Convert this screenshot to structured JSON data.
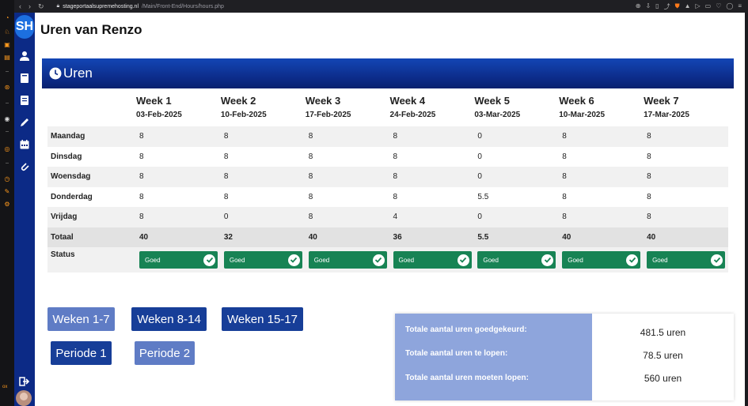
{
  "browser": {
    "host": "stageportaalsupremehosting.nl",
    "path": "/Main/Front-End/Hours/hours.php"
  },
  "os_bar": {
    "label": "ox"
  },
  "sidebar": {
    "logo_text": "SH",
    "items": [
      {
        "icon": "user-icon"
      },
      {
        "icon": "book-icon"
      },
      {
        "icon": "notebook-icon"
      },
      {
        "icon": "pencil-icon"
      },
      {
        "icon": "calendar-icon"
      },
      {
        "icon": "paperclip-icon"
      }
    ],
    "logout_icon": "logout-icon"
  },
  "page": {
    "title": "Uren van Renzo",
    "card_title": "Uren"
  },
  "hours_table": {
    "weeks": [
      {
        "label": "Week 1",
        "date": "03-Feb-2025"
      },
      {
        "label": "Week 2",
        "date": "10-Feb-2025"
      },
      {
        "label": "Week 3",
        "date": "17-Feb-2025"
      },
      {
        "label": "Week 4",
        "date": "24-Feb-2025"
      },
      {
        "label": "Week 5",
        "date": "03-Mar-2025"
      },
      {
        "label": "Week 6",
        "date": "10-Mar-2025"
      },
      {
        "label": "Week 7",
        "date": "17-Mar-2025"
      }
    ],
    "rows": [
      {
        "day": "Maandag",
        "values": [
          "8",
          "8",
          "8",
          "8",
          "0",
          "8",
          "8"
        ]
      },
      {
        "day": "Dinsdag",
        "values": [
          "8",
          "8",
          "8",
          "8",
          "0",
          "8",
          "8"
        ]
      },
      {
        "day": "Woensdag",
        "values": [
          "8",
          "8",
          "8",
          "8",
          "0",
          "8",
          "8"
        ]
      },
      {
        "day": "Donderdag",
        "values": [
          "8",
          "8",
          "8",
          "8",
          "5.5",
          "8",
          "8"
        ]
      },
      {
        "day": "Vrijdag",
        "values": [
          "8",
          "0",
          "8",
          "4",
          "0",
          "8",
          "8"
        ]
      }
    ],
    "total": {
      "label": "Totaal",
      "values": [
        "40",
        "32",
        "40",
        "36",
        "5.5",
        "40",
        "40"
      ]
    },
    "status": {
      "label": "Status",
      "values": [
        "Goed",
        "Goed",
        "Goed",
        "Goed",
        "Goed",
        "Goed",
        "Goed"
      ]
    },
    "status_color": "#178354"
  },
  "range_buttons": [
    {
      "label": "Weken 1-7",
      "state": "inactive"
    },
    {
      "label": "Weken 8-14",
      "state": "active"
    },
    {
      "label": "Weken 15-17",
      "state": "active"
    }
  ],
  "period_buttons": [
    {
      "label": "Periode 1",
      "state": "active"
    },
    {
      "label": "Periode 2",
      "state": "inactive"
    }
  ],
  "summary": {
    "approved_label": "Totale aantal uren goedgekeurd:",
    "approved_value": "481.5 uren",
    "remaining_label": "Totale aantal uren te lopen:",
    "remaining_value": "78.5 uren",
    "required_label": "Totale aantal uren moeten lopen:",
    "required_value": "560 uren"
  },
  "colors": {
    "sidebar": "#0c2a86",
    "header_blue": "#1346b5",
    "button_active": "#173e98",
    "button_inactive": "#5f7cc5",
    "summary_panel": "#8ea5dc"
  }
}
